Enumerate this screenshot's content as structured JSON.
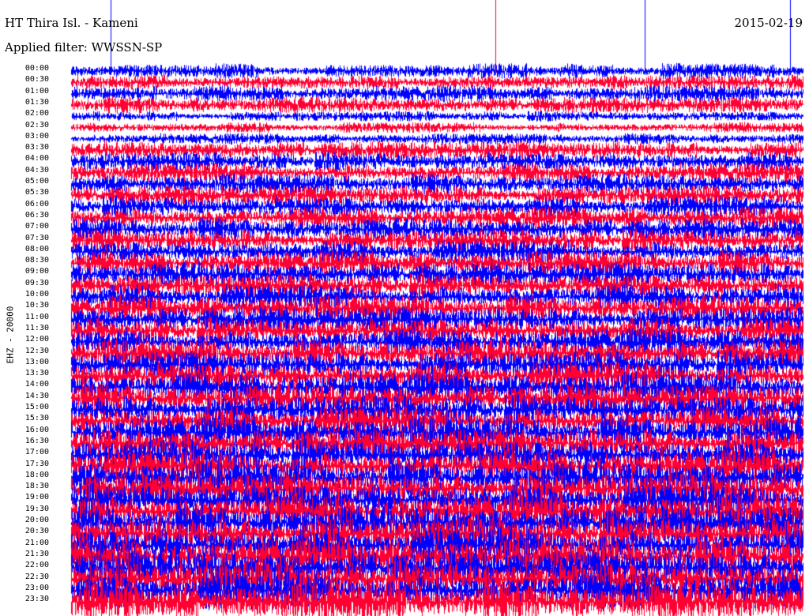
{
  "header": {
    "title": "HT Thira Isl. - Kameni",
    "date": "2015-02-19",
    "filter": "Applied filter: WWSSN-SP"
  },
  "chart_data": {
    "type": "line",
    "title": "HT Thira Isl. - Kameni",
    "date": "2015-02-19",
    "channel_label": "EHZ - 20000",
    "y_tick_labels": [
      "00:00",
      "00:30",
      "01:00",
      "01:30",
      "02:00",
      "02:30",
      "03:00",
      "03:30",
      "04:00",
      "04:30",
      "05:00",
      "05:30",
      "06:00",
      "06:30",
      "07:00",
      "07:30",
      "08:00",
      "08:30",
      "09:00",
      "09:30",
      "10:00",
      "10:30",
      "11:00",
      "11:30",
      "12:00",
      "12:30",
      "13:00",
      "13:30",
      "14:00",
      "14:30",
      "15:00",
      "15:30",
      "16:00",
      "16:30",
      "17:00",
      "17:30",
      "18:00",
      "18:30",
      "19:00",
      "19:30",
      "20:00",
      "20:30",
      "21:00",
      "21:30",
      "22:00",
      "22:30",
      "23:00",
      "23:30"
    ],
    "line_colors": [
      "#0000ff",
      "#ff0033"
    ],
    "background": "#ffffff",
    "grid": false
  }
}
